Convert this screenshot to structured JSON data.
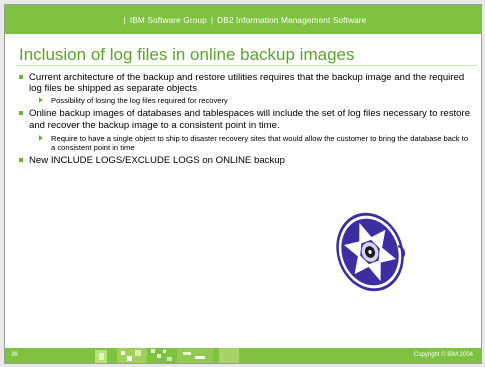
{
  "header": {
    "group": "IBM Software Group",
    "separator": "|",
    "product": "DB2 Information Management Software"
  },
  "title": "Inclusion of log files in online backup images",
  "bullets": [
    {
      "text": "Current architecture of the backup and restore utilities requires that the backup image and the required log files be shipped as separate objects",
      "subs": [
        "Possibility of losing the log files required for recovery"
      ]
    },
    {
      "text": "Online backup images of databases and tablespaces will include the set of log files necessary to restore and recover the backup image to a consistent point in time.",
      "subs": [
        "Require to have a single object to ship to disaster recovery sites that would allow the customer to bring the database back to a consistent point in time"
      ]
    },
    {
      "text": "New INCLUDE LOGS/EXCLUDE LOGS on ONLINE backup",
      "subs": []
    }
  ],
  "footer": {
    "page_number": "36",
    "copyright": "Copyright © IBM 2004"
  },
  "colors": {
    "brand_green": "#7fc241",
    "title_green": "#5fa32b",
    "reel_blue": "#3b2ea0"
  },
  "icons": {
    "reel": "tape-reel-icon",
    "bullet": "square-bullet-icon",
    "sub_bullet": "triangle-bullet-icon"
  }
}
